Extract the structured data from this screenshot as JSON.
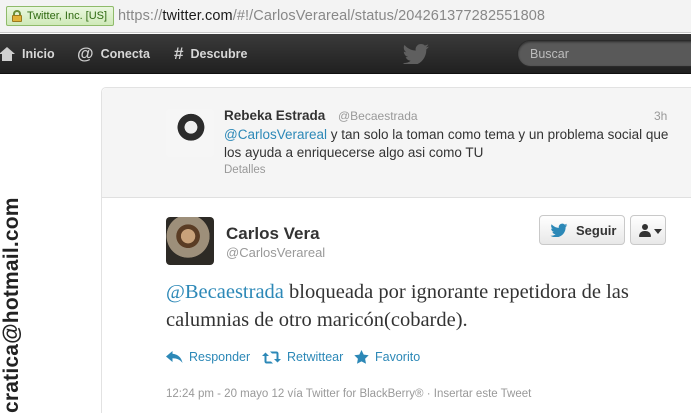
{
  "browser": {
    "identity_label": "Twitter, Inc. [US]",
    "url_scheme": "https://",
    "url_host": "twitter.com",
    "url_path": "/#!/CarlosVerareal/status/204261377282551808"
  },
  "nav": {
    "home_label": "Inicio",
    "connect_label": "Conecta",
    "discover_label": "Descubre",
    "search_placeholder": "Buscar"
  },
  "watermark": "cratica@hotmail.com",
  "reply_tweet": {
    "name": "Rebeka Estrada",
    "handle": "@Becaestrada",
    "time": "3h",
    "mention": "@CarlosVerareal",
    "text": " y tan solo la toman como tema y un problema social que los ayuda a enriquecerse algo asi como TU",
    "details_label": "Detalles"
  },
  "main_tweet": {
    "name": "Carlos Vera",
    "handle": "@CarlosVerareal",
    "follow_label": "Seguir",
    "mention": "@Becaestrada",
    "text": " bloqueada por ignorante repetidora de las calumnias de otro maricón(cobarde).",
    "reply_label": "Responder",
    "retweet_label": "Retwittear",
    "favorite_label": "Favorito",
    "meta": "12:24 pm - 20 mayo 12 vía Twitter for BlackBerry® · Insertar este Tweet"
  },
  "colors": {
    "link": "#2c88b7",
    "topbar": "#2a2a2a"
  }
}
